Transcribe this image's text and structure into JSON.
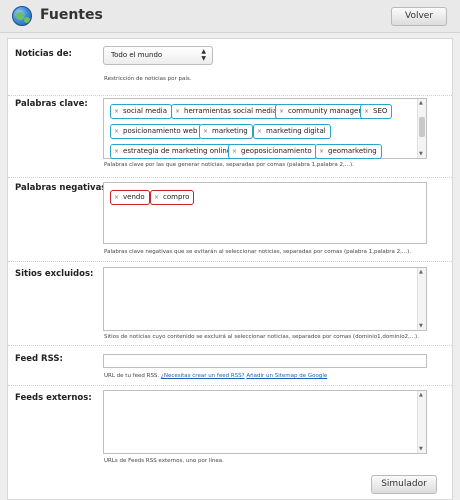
{
  "header": {
    "title": "Fuentes",
    "back_label": "Volver"
  },
  "noticias": {
    "label": "Noticias de:",
    "selected": "Todo el mundo",
    "hint": "Restricción de noticias por país."
  },
  "palabras": {
    "label": "Palabras clave:",
    "tags": [
      "social media",
      "herramientas social media",
      "community manager",
      "SEO",
      "posicionamiento web",
      "marketing",
      "marketing digital",
      "estrategia de marketing online",
      "geoposicionamiento",
      "geomarketing"
    ],
    "hint": "Palabras clave por las que generar noticias, separadas por comas (palabra 1,palabra 2,...)."
  },
  "negativas": {
    "label": "Palabras negativas:",
    "tags": [
      "vendo",
      "compro"
    ],
    "hint": "Palabras clave negativas que se evitarán al seleccionar noticias, separadas por comas (palabra 1,palabra 2,...)."
  },
  "sitios": {
    "label": "Sitios excluidos:",
    "hint": "Sitios de noticias cuyo contenido se excluirá al seleccionar noticias, separados por comas (dominio1,dominio2,...)."
  },
  "feed": {
    "label": "Feed RSS:",
    "hint_text": "URL de tu feed RSS.",
    "link1": "¿Necesitas crear un feed RSS?",
    "link2": "Añadir un Sitemap de Google"
  },
  "externos": {
    "label": "Feeds externos:",
    "hint": "URLs de Feeds RSS externos, uno por línea."
  },
  "footer": {
    "simulate_label": "Simulador"
  },
  "icons": {
    "tag_remove": "×",
    "select_arrows": "⬍",
    "scroll_up": "▲",
    "scroll_down": "▼"
  },
  "colors": {
    "tag_border": "#2aa5c9",
    "negative_tag_border": "#c9202a",
    "link": "#1a5fb4"
  }
}
